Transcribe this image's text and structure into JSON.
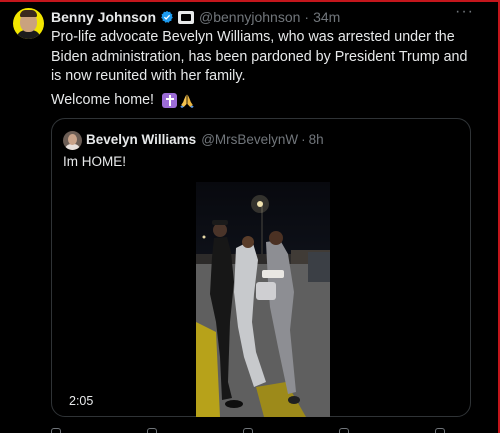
{
  "tweet": {
    "author_name": "Benny Johnson",
    "author_handle": "@bennyjohnson",
    "separator": "·",
    "time": "34m",
    "more_label": "···",
    "text": "Pro-life advocate Bevelyn Williams, who was arrested under the Biden administration, has been pardoned by President Trump and is now reunited with her family.",
    "welcome": "Welcome home!",
    "icons": [
      "verified-badge-icon",
      "affiliate-badge-icon",
      "more-options-icon",
      "latin-cross-emoji",
      "praying-hands-emoji"
    ]
  },
  "quote": {
    "author_name": "Bevelyn Williams",
    "author_handle": "@MrsBevelynW",
    "separator": "·",
    "time": "8h",
    "text": "Im HOME!",
    "video_duration": "2:05"
  },
  "colors": {
    "background": "#000000",
    "text_primary": "#e7e9ea",
    "text_secondary": "#71767b",
    "border": "#2f3336",
    "verified_blue": "#1d9bf0",
    "frame_red": "#c4161c"
  }
}
